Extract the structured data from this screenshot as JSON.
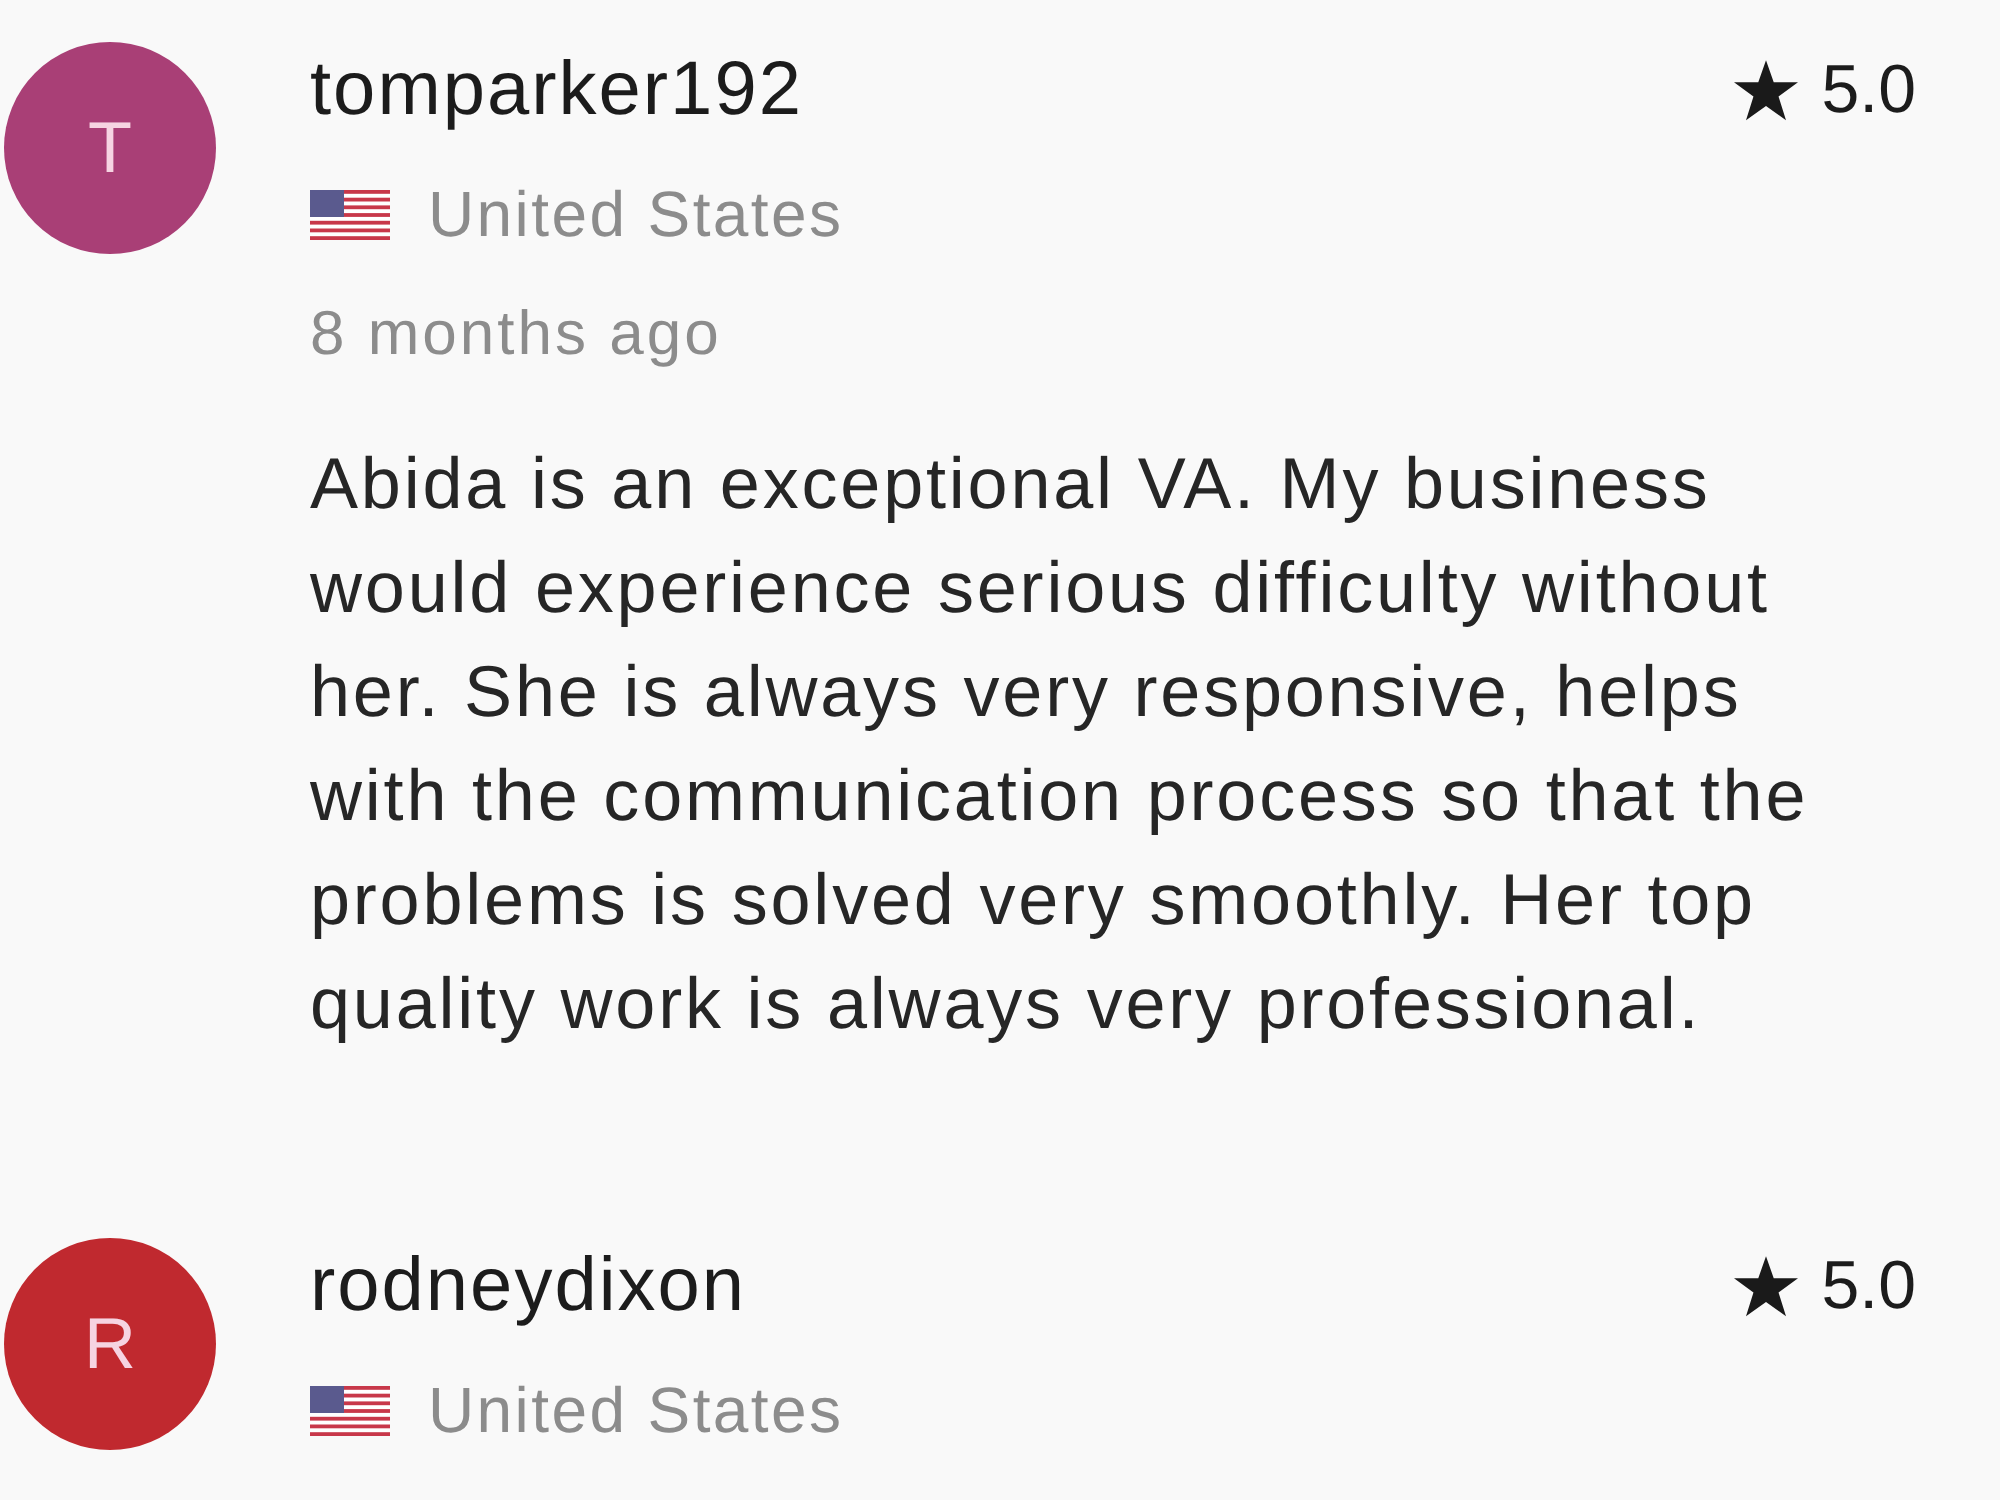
{
  "reviews": [
    {
      "avatar": {
        "letter": "T",
        "color": "#a93f76"
      },
      "username": "tomparker192",
      "rating": "5.0",
      "country": "United States",
      "time": "8 months ago",
      "text": "Abida is an exceptional VA. My business would experience serious difficulty without her. She is always very responsive, helps with the communication process so that the problems is solved very smoothly. Her top quality work is always very professional."
    },
    {
      "avatar": {
        "letter": "R",
        "color": "#c0292f"
      },
      "username": "rodneydixon",
      "rating": "5.0",
      "country": "United States"
    }
  ]
}
